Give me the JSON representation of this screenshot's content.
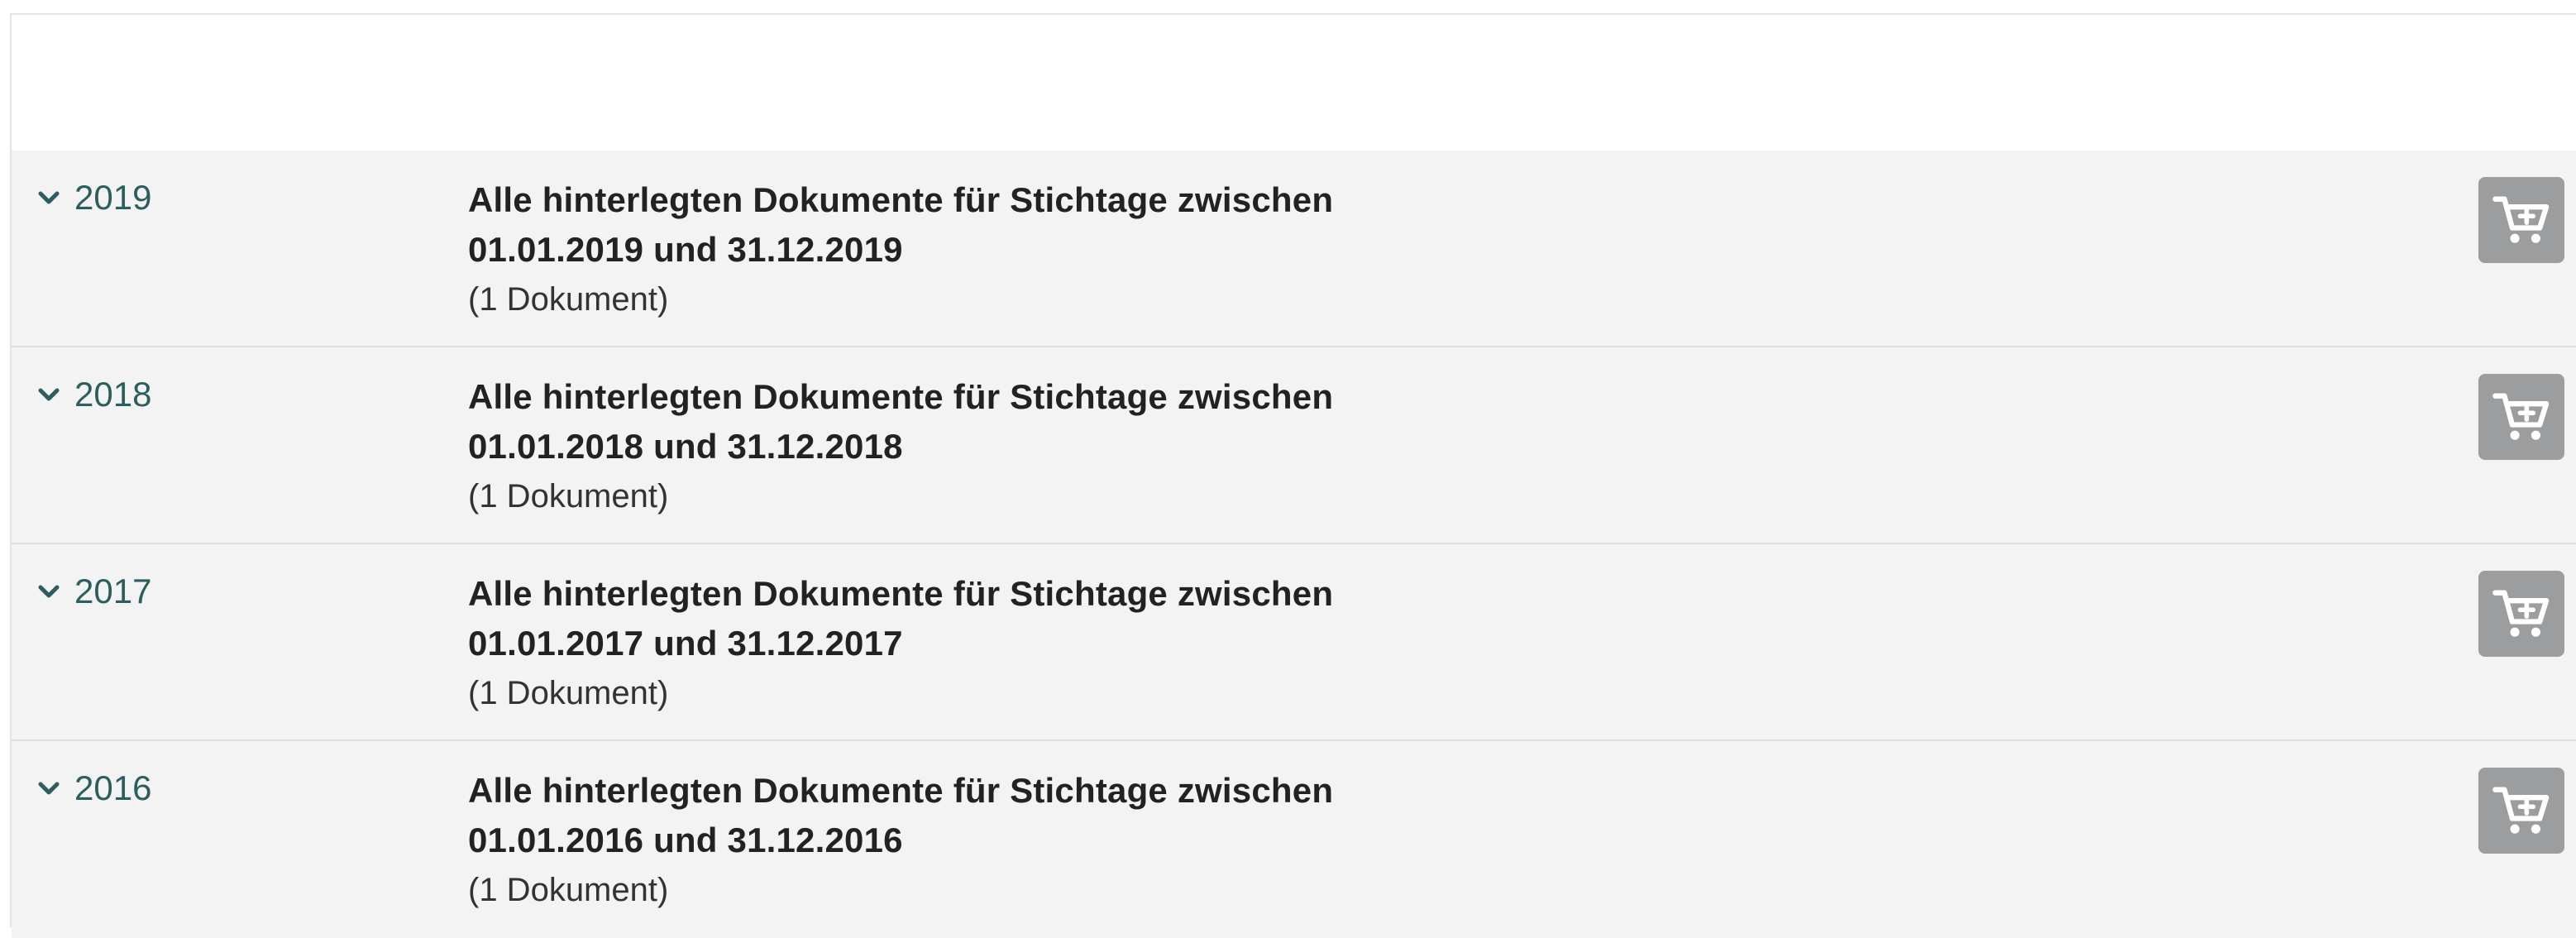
{
  "colors": {
    "accent": "#2c5e60",
    "row_bg": "#f3f3f3",
    "cart_button_bg": "#9b9d9f"
  },
  "rows": [
    {
      "year": "2019",
      "title": "Alle hinterlegten Dokumente für Stichtage zwischen 01.01.2019 und 31.12.2019",
      "count": "(1 Dokument)",
      "icon": "cart-add-icon"
    },
    {
      "year": "2018",
      "title": "Alle hinterlegten Dokumente für Stichtage zwischen 01.01.2018 und 31.12.2018",
      "count": "(1 Dokument)",
      "icon": "cart-add-icon"
    },
    {
      "year": "2017",
      "title": "Alle hinterlegten Dokumente für Stichtage zwischen 01.01.2017 und 31.12.2017",
      "count": "(1 Dokument)",
      "icon": "cart-add-icon"
    },
    {
      "year": "2016",
      "title": "Alle hinterlegten Dokumente für Stichtage zwischen 01.01.2016 und 31.12.2016",
      "count": "(1 Dokument)",
      "icon": "cart-add-icon"
    }
  ]
}
